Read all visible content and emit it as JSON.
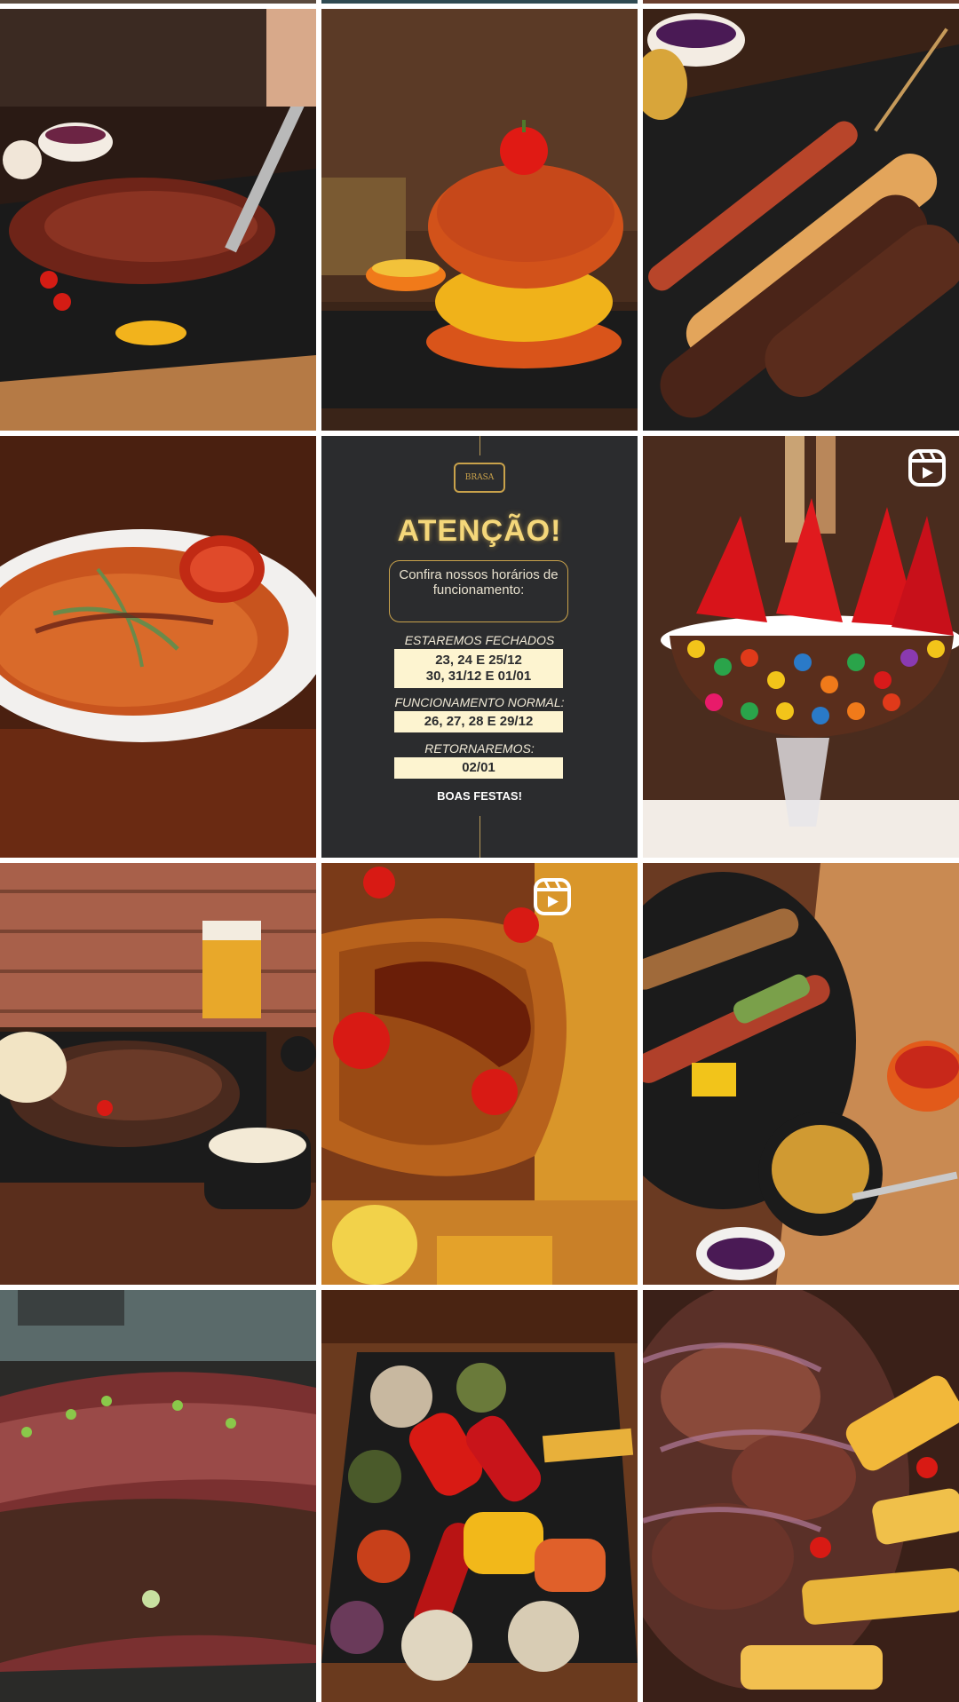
{
  "notice": {
    "logo_text": "BRASA",
    "title": "ATENÇÃO!",
    "box_text": "Confira nossos horários de funcionamento:",
    "closed_label": "ESTAREMOS FECHADOS",
    "closed_dates_1": "23, 24 E 25/12",
    "closed_dates_2": "30, 31/12 E 01/01",
    "normal_label": "FUNCIONAMENTO NORMAL:",
    "normal_dates": "26, 27, 28 E 29/12",
    "return_label": "RETORNAREMOS:",
    "return_date": "02/01",
    "greeting": "BOAS FESTAS!"
  },
  "posts": [
    {
      "name": "steak-on-stone",
      "reel": false
    },
    {
      "name": "orange-burger",
      "reel": false
    },
    {
      "name": "skewers",
      "reel": false
    },
    {
      "name": "risotto",
      "reel": false
    },
    {
      "name": "holiday-notice",
      "reel": false
    },
    {
      "name": "candy-dessert",
      "reel": true
    },
    {
      "name": "meat-board-beer",
      "reel": false
    },
    {
      "name": "fried-pork-rind",
      "reel": true
    },
    {
      "name": "grill-plate-farofa",
      "reel": false
    },
    {
      "name": "ribeye-closeup",
      "reel": false
    },
    {
      "name": "grilled-vegetables",
      "reel": false
    },
    {
      "name": "meat-and-fries",
      "reel": false
    }
  ],
  "icons": {
    "reel": "reels-icon"
  },
  "colors": {
    "background": "#ffffff",
    "notice_bg": "#2b2c2e",
    "notice_gold": "#f4d77a"
  }
}
